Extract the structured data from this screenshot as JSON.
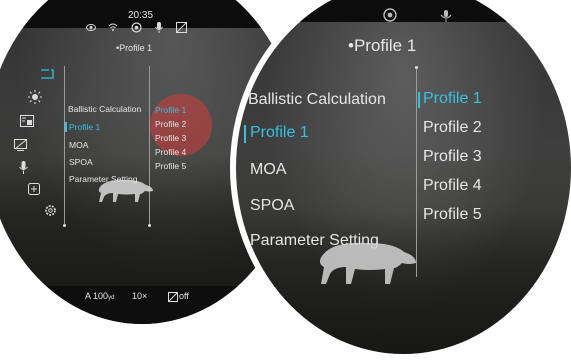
{
  "status_bar": {
    "time": "20:35"
  },
  "header": {
    "title": "Profile 1"
  },
  "menu": {
    "items": [
      {
        "label": "Ballistic Calculation"
      },
      {
        "label": "Profile 1"
      },
      {
        "label": "MOA"
      },
      {
        "label": "SPOA"
      },
      {
        "label": "Parameter Setting"
      }
    ],
    "selected_index": 1
  },
  "submenu": {
    "items": [
      {
        "label": "Profile 1"
      },
      {
        "label": "Profile 2"
      },
      {
        "label": "Profile 3"
      },
      {
        "label": "Profile 4"
      },
      {
        "label": "Profile 5"
      }
    ],
    "selected_index": 0
  },
  "bottom_bar": {
    "distance_prefix": "A",
    "distance_value": "100",
    "distance_unit": "yd",
    "zoom": "10×",
    "overlay_state": "off"
  },
  "sidebar_icons": [
    "profile-icon",
    "brightness-icon",
    "picture-in-picture-icon",
    "display-off-icon",
    "microphone-icon",
    "add-icon",
    "settings-icon"
  ],
  "colors": {
    "highlight": "#35c0e0",
    "text": "#e6e6e6",
    "marker": "#d84a4a"
  }
}
